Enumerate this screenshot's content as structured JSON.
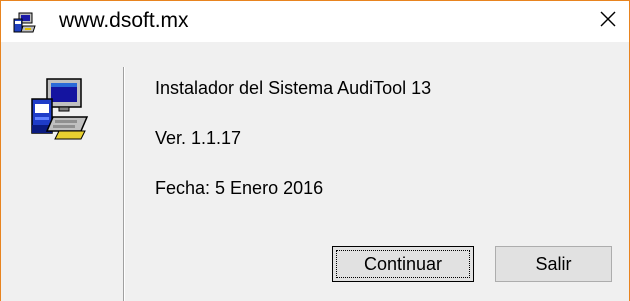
{
  "window": {
    "title": "www.dsoft.mx",
    "title_icon": "computer-setup-icon",
    "close_icon": "close-icon"
  },
  "content": {
    "app_icon": "computer-setup-icon",
    "line1": "Instalador del Sistema AudiTool 13",
    "line2": "Ver. 1.1.17",
    "line3": "Fecha: 5 Enero 2016"
  },
  "buttons": {
    "continue_label": "Continuar",
    "exit_label": "Salir"
  },
  "colors": {
    "window_border": "#e8841f",
    "client_background": "#f0f0f0",
    "button_face": "#e1e1e1"
  }
}
